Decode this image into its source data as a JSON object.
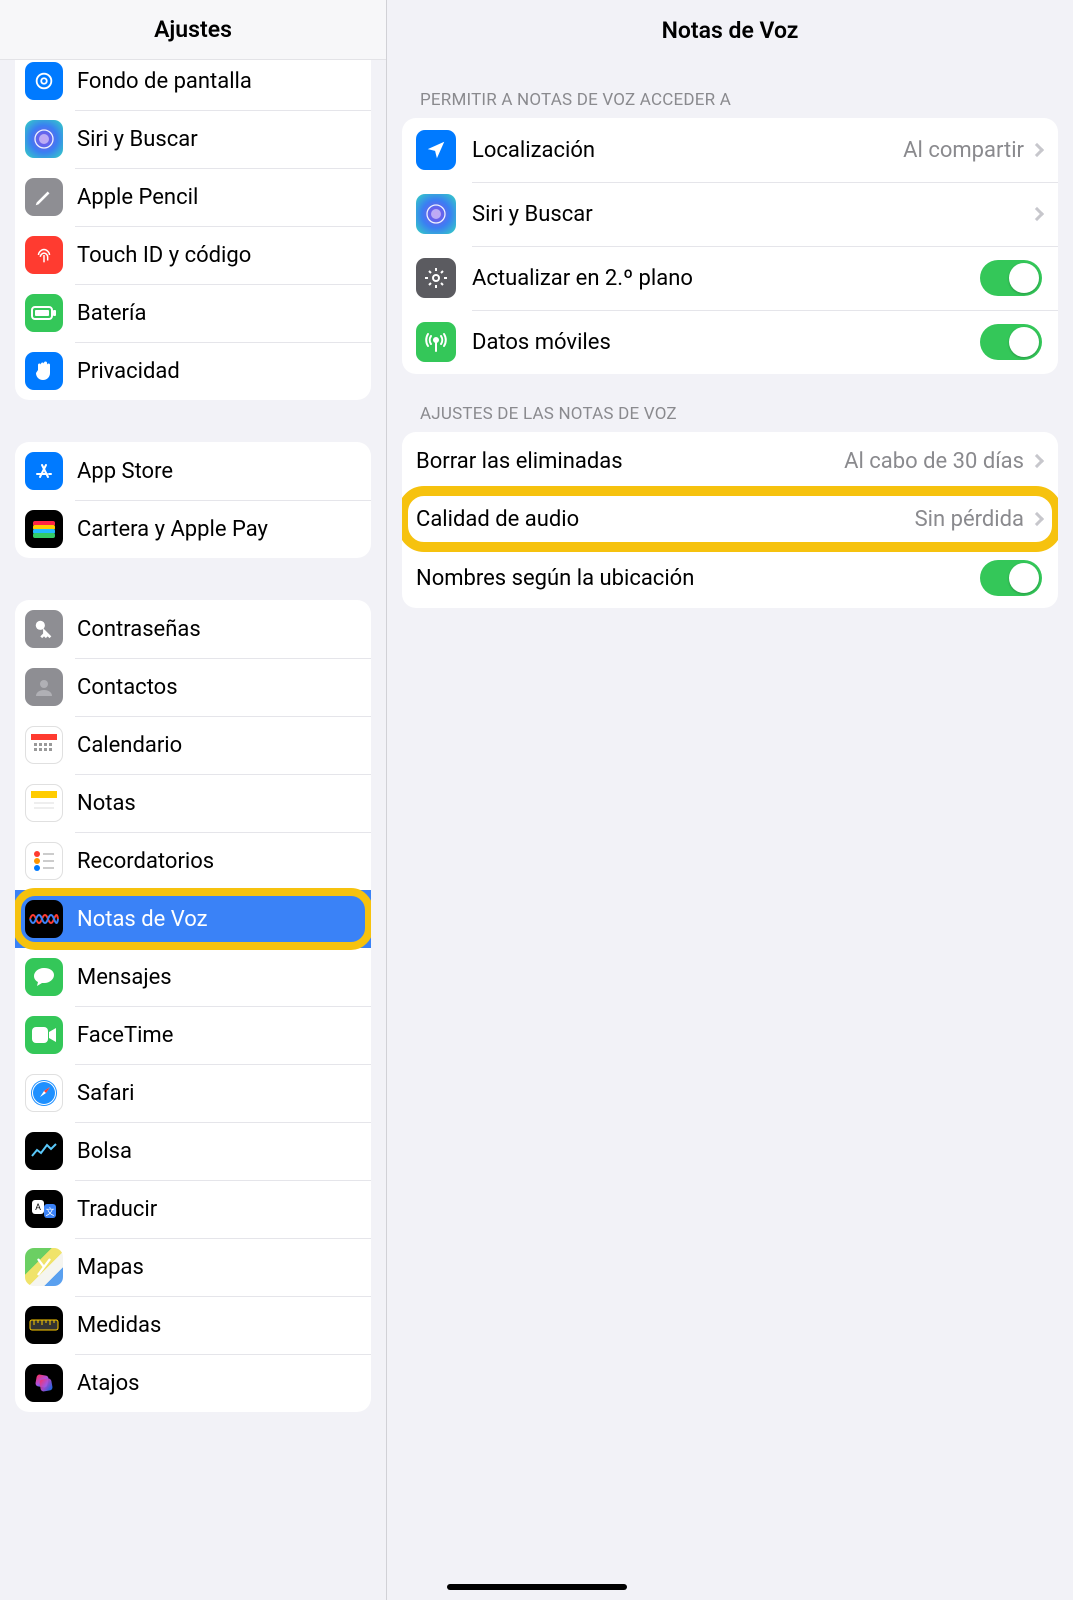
{
  "sidebar": {
    "title": "Ajustes",
    "group1": [
      {
        "label": "Fondo de pantalla",
        "icon": "wallpaper-icon",
        "bg": "bg-blue"
      },
      {
        "label": "Siri y Buscar",
        "icon": "siri-icon",
        "bg": "bg-siri"
      },
      {
        "label": "Apple Pencil",
        "icon": "pencil-icon",
        "bg": "bg-gray"
      },
      {
        "label": "Touch ID y código",
        "icon": "fingerprint-icon",
        "bg": "bg-red"
      },
      {
        "label": "Batería",
        "icon": "battery-icon",
        "bg": "bg-green"
      },
      {
        "label": "Privacidad",
        "icon": "hand-icon",
        "bg": "bg-blue"
      }
    ],
    "group2": [
      {
        "label": "App Store",
        "icon": "appstore-icon",
        "bg": "bg-blue"
      },
      {
        "label": "Cartera y Apple Pay",
        "icon": "wallet-icon",
        "bg": "bg-black"
      }
    ],
    "group3": [
      {
        "label": "Contraseñas",
        "icon": "key-icon",
        "bg": "bg-gray"
      },
      {
        "label": "Contactos",
        "icon": "contacts-icon",
        "bg": "bg-gray"
      },
      {
        "label": "Calendario",
        "icon": "calendar-icon",
        "bg": "bg-white"
      },
      {
        "label": "Notas",
        "icon": "notes-icon",
        "bg": "bg-white"
      },
      {
        "label": "Recordatorios",
        "icon": "reminders-icon",
        "bg": "bg-white"
      },
      {
        "label": "Notas de Voz",
        "icon": "voicememos-icon",
        "bg": "bg-black",
        "selected": true,
        "highlight": true
      },
      {
        "label": "Mensajes",
        "icon": "messages-icon",
        "bg": "bg-green"
      },
      {
        "label": "FaceTime",
        "icon": "facetime-icon",
        "bg": "bg-green"
      },
      {
        "label": "Safari",
        "icon": "safari-icon",
        "bg": "bg-white"
      },
      {
        "label": "Bolsa",
        "icon": "stocks-icon",
        "bg": "bg-black"
      },
      {
        "label": "Traducir",
        "icon": "translate-icon",
        "bg": "bg-black"
      },
      {
        "label": "Mapas",
        "icon": "maps-icon",
        "bg": "bg-maps"
      },
      {
        "label": "Medidas",
        "icon": "measure-icon",
        "bg": "bg-black"
      },
      {
        "label": "Atajos",
        "icon": "shortcuts-icon",
        "bg": "bg-black"
      }
    ]
  },
  "detail": {
    "title": "Notas de Voz",
    "section1_header": "PERMITIR A NOTAS DE VOZ ACCEDER A",
    "section1": [
      {
        "label": "Localización",
        "value": "Al compartir",
        "icon": "location-icon",
        "bg": "bg-blue",
        "type": "nav"
      },
      {
        "label": "Siri y Buscar",
        "icon": "siri-icon",
        "bg": "bg-siri",
        "type": "nav"
      },
      {
        "label": "Actualizar en 2.º plano",
        "icon": "gear-icon",
        "bg": "bg-dgray",
        "type": "toggle",
        "on": true
      },
      {
        "label": "Datos móviles",
        "icon": "antenna-icon",
        "bg": "bg-green",
        "type": "toggle",
        "on": true
      }
    ],
    "section2_header": "AJUSTES DE LAS NOTAS DE VOZ",
    "section2": [
      {
        "label": "Borrar las eliminadas",
        "value": "Al cabo de 30 días",
        "type": "nav"
      },
      {
        "label": "Calidad de audio",
        "value": "Sin pérdida",
        "type": "nav",
        "highlight": true
      },
      {
        "label": "Nombres según la ubicación",
        "type": "toggle",
        "on": true
      }
    ]
  }
}
